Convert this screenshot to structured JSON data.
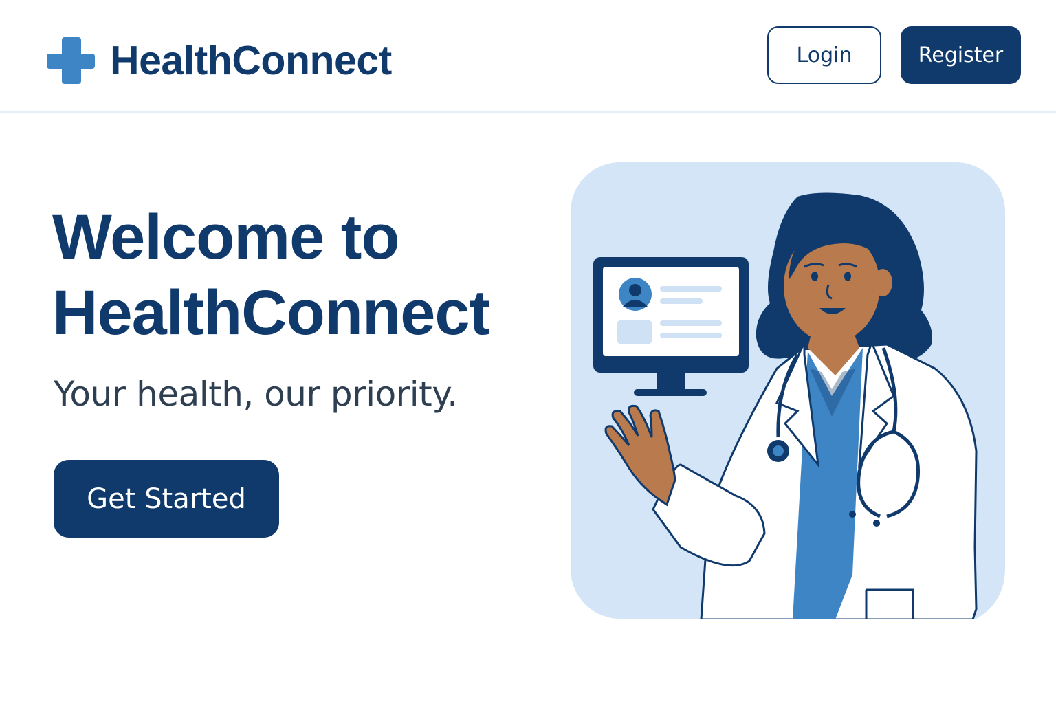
{
  "header": {
    "brand": "HealthConnect",
    "logo_icon": "medical-cross-icon",
    "login_label": "Login",
    "register_label": "Register"
  },
  "hero": {
    "title_line1": "Welcome to",
    "title_line2": "HealthConnect",
    "subtitle": "Your health, our priority.",
    "cta_label": "Get Started",
    "illustration": "doctor-illustration"
  },
  "colors": {
    "primary": "#0f3a6b",
    "accent": "#3e85c6",
    "illustration_bg": "#d3e5f6",
    "text_secondary": "#2e3f52"
  }
}
